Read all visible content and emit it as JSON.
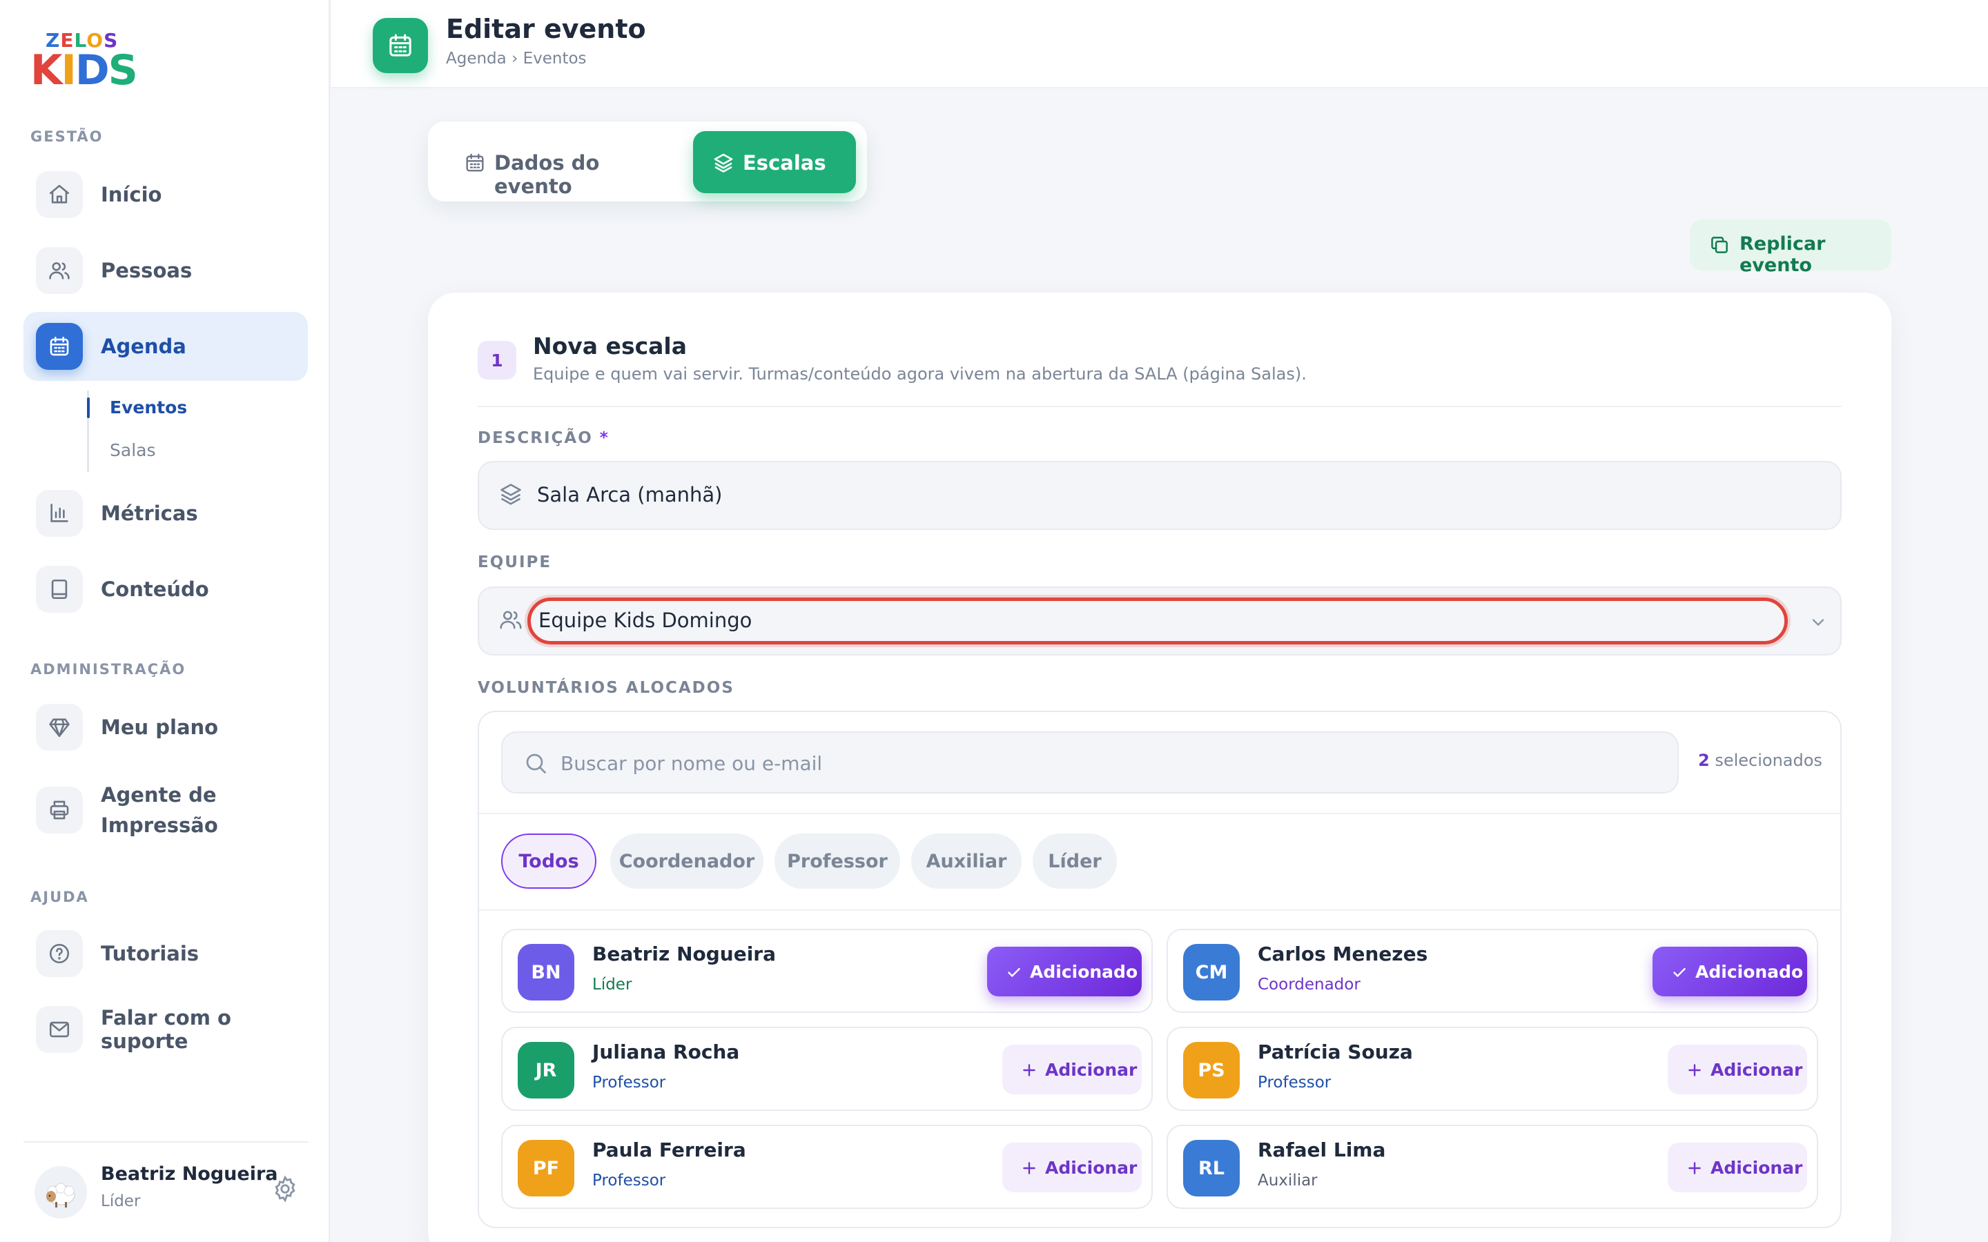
{
  "brand": {
    "line1": "ZELOS",
    "line2": "KIDS"
  },
  "sidebar": {
    "sections": {
      "gestao": "GESTÃO",
      "administracao": "ADMINISTRAÇÃO",
      "ajuda": "AJUDA"
    },
    "items": {
      "inicio": "Início",
      "pessoas": "Pessoas",
      "agenda": "Agenda",
      "metricas": "Métricas",
      "conteudo": "Conteúdo",
      "meu_plano": "Meu plano",
      "agente_l1": "Agente de",
      "agente_l2": "Impressão",
      "tutoriais": "Tutoriais",
      "suporte": "Falar com o suporte"
    },
    "subitems": {
      "eventos": "Eventos",
      "salas": "Salas"
    },
    "active": "agenda"
  },
  "user": {
    "name": "Beatriz Nogueira",
    "role": "Líder"
  },
  "header": {
    "title": "Editar evento",
    "breadcrumb": "Agenda › Eventos"
  },
  "tabs": {
    "dados": "Dados do evento",
    "escalas": "Escalas",
    "active": "escalas"
  },
  "actions": {
    "replicar": "Replicar evento"
  },
  "step": {
    "number": "1",
    "title": "Nova escala",
    "subtitle": "Equipe e quem vai servir. Turmas/conteúdo agora vivem na abertura da SALA (página Salas)."
  },
  "form": {
    "descricao_label": "DESCRIÇÃO",
    "required_mark": "*",
    "descricao_value": "Sala Arca (manhã)",
    "equipe_label": "EQUIPE",
    "equipe_value": "Equipe Kids Domingo",
    "voluntarios_label": "VOLUNTÁRIOS ALOCADOS"
  },
  "search": {
    "placeholder": "Buscar por nome ou e-mail",
    "selected_count": "2",
    "selected_suffix": " selecionados"
  },
  "filters": [
    "Todos",
    "Coordenador",
    "Professor",
    "Auxiliar",
    "Líder"
  ],
  "active_filter": "Todos",
  "volunteers": [
    {
      "initials": "BN",
      "name": "Beatriz Nogueira",
      "role": "Líder",
      "status": "Adicionado",
      "avatar_color": "#6d5ce8",
      "role_color": "#137a52"
    },
    {
      "initials": "CM",
      "name": "Carlos Menezes",
      "role": "Coordenador",
      "status": "Adicionado",
      "avatar_color": "#3a7bd5",
      "role_color": "#6d35c8"
    },
    {
      "initials": "JR",
      "name": "Juliana Rocha",
      "role": "Professor",
      "status": "Adicionar",
      "avatar_color": "#1a9e6a",
      "role_color": "#1e4fa8"
    },
    {
      "initials": "PS",
      "name": "Patrícia Souza",
      "role": "Professor",
      "status": "Adicionar",
      "avatar_color": "#f0a11a",
      "role_color": "#1e4fa8"
    },
    {
      "initials": "PF",
      "name": "Paula Ferreira",
      "role": "Professor",
      "status": "Adicionar",
      "avatar_color": "#f0a11a",
      "role_color": "#1e4fa8"
    },
    {
      "initials": "RL",
      "name": "Rafael Lima",
      "role": "Auxiliar",
      "status": "Adicionar",
      "avatar_color": "#3a7bd5",
      "role_color": "#5a6475"
    }
  ],
  "colors": {
    "primary_green": "#1fae78",
    "accent_purple": "#6d35c8",
    "agenda_blue": "#2f6fd6",
    "highlight_red": "#e0443b"
  }
}
